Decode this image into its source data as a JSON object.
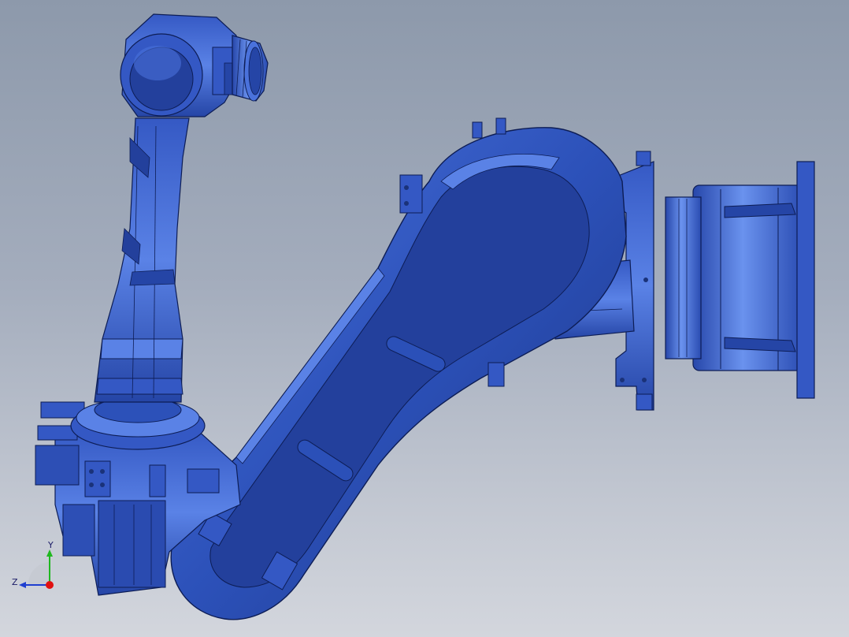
{
  "viewport": {
    "background_top": "#8d99ab",
    "background_bottom": "#d3d6dd",
    "model_color": "#2b50b8",
    "model_highlight": "#4f78e0",
    "model_shadow": "#1a3279",
    "edge_color": "#0d1d55"
  },
  "model": {
    "icon": "robot-arm-model"
  },
  "triad": {
    "y_label": "Y",
    "z_label": "Z",
    "y_color": "#1fb81f",
    "z_color": "#1f3fd0",
    "x_color": "#e01010"
  }
}
